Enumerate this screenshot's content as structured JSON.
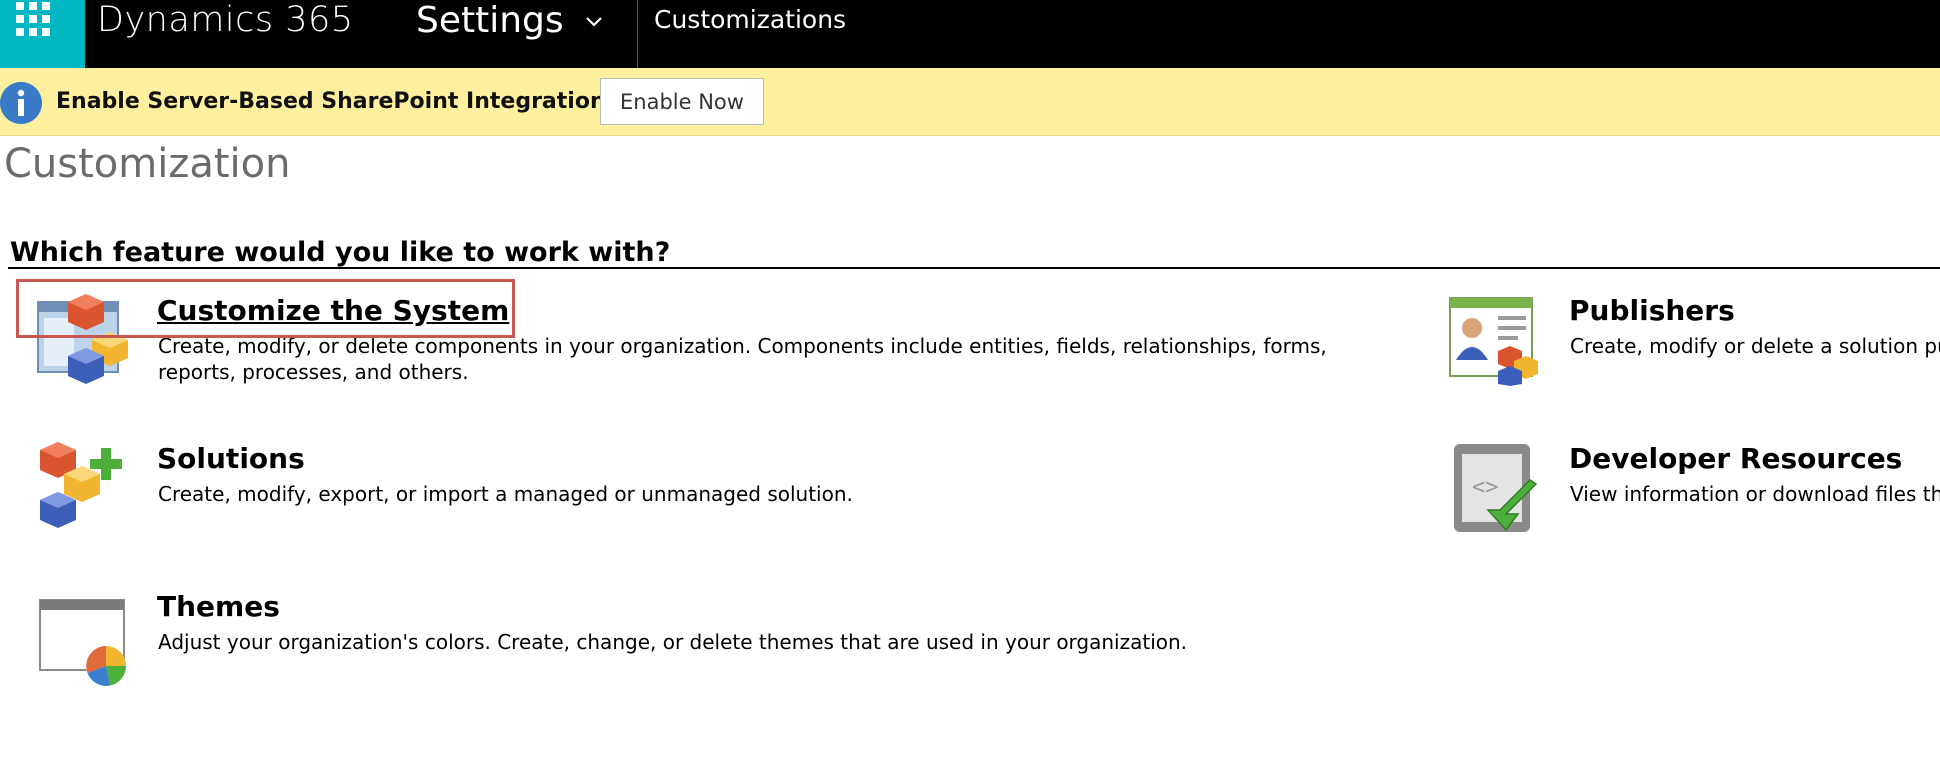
{
  "topbar": {
    "app_title": "Dynamics 365",
    "area_title": "Settings",
    "breadcrumb": "Customizations",
    "waffle_icon": "app-launcher-icon",
    "chevron_icon": "chevron-down-icon",
    "background_color": "#000000",
    "waffle_color": "#00b7c3"
  },
  "notification": {
    "text": "Enable Server-Based SharePoint Integration",
    "button_label": "Enable Now",
    "icon": "info-icon",
    "background_color": "#fff0a0"
  },
  "page": {
    "title": "Customization",
    "question": "Which feature would you like to work with?"
  },
  "features": {
    "customize": {
      "title": "Customize the System",
      "description": "Create, modify, or delete components in your organization. Components include entities, fields, relationships, forms, reports, processes, and others.",
      "icon": "customize-system-icon",
      "highlighted": true
    },
    "solutions": {
      "title": "Solutions",
      "description": "Create, modify, export, or import a managed or unmanaged solution.",
      "icon": "solutions-icon"
    },
    "themes": {
      "title": "Themes",
      "description": "Adjust your organization's colors. Create, change, or delete themes that are used in your organization.",
      "icon": "themes-icon"
    },
    "publishers": {
      "title": "Publishers",
      "description": "Create, modify or delete a solution pul",
      "icon": "publishers-icon"
    },
    "developer": {
      "title": "Developer Resources",
      "description": "View information or download files tha",
      "icon": "developer-resources-icon"
    }
  },
  "colors": {
    "highlight_border": "#c8574f",
    "page_title": "#6b6b6b"
  }
}
